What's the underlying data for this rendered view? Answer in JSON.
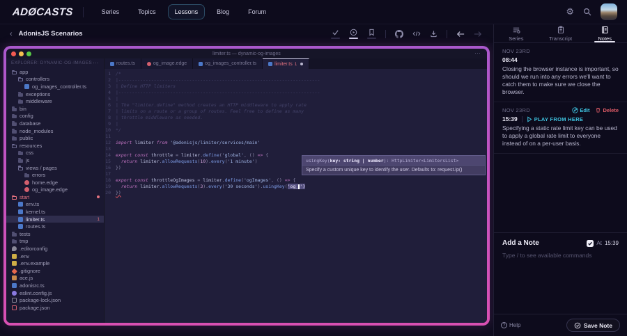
{
  "colors": {
    "page_bg": "#0d0b1c",
    "panel_border": "#201e33",
    "accent_cyan": "#3fc4e0",
    "accent_red": "#e25d68",
    "accent_salmon": "#e57380",
    "chrome_bg": "#161528",
    "explorer_bg": "#1a1831",
    "editor_bg": "#201e3a",
    "ts_blue": "#4c78c8",
    "edge_red": "#d35f6e",
    "window_border_top": "#aa58cc",
    "window_border_bottom": "#d950b2"
  },
  "navbar": {
    "brand": "ADØCASTS",
    "items": [
      {
        "label": "Series",
        "active": false
      },
      {
        "label": "Topics",
        "active": false
      },
      {
        "label": "Lessons",
        "active": true
      },
      {
        "label": "Blog",
        "active": false
      },
      {
        "label": "Forum",
        "active": false
      }
    ],
    "icons": [
      "gear-icon",
      "search-icon",
      "avatar"
    ]
  },
  "lesson_bar": {
    "back_icon": "‹",
    "title": "AdonisJS Scenarios",
    "tools": [
      {
        "name": "mark-complete",
        "icon": "check",
        "underline": "dim"
      },
      {
        "name": "autoplay",
        "icon": "play-circle",
        "underline": "bright"
      },
      {
        "name": "bookmark",
        "icon": "bookmark",
        "underline": "dim"
      },
      {
        "name": "github",
        "icon": "github"
      },
      {
        "name": "embed",
        "icon": "code"
      },
      {
        "name": "download",
        "icon": "download"
      },
      {
        "name": "previous-lesson",
        "icon": "arrow-left",
        "disabled": false
      },
      {
        "name": "next-lesson",
        "icon": "arrow-right",
        "disabled": true
      }
    ]
  },
  "editor": {
    "window_title": "limiter.ts — dynamic-og-images",
    "explorer_header": "EXPLORER: DYNAMIC-OG-IMAGES",
    "more_glyph": "⋯",
    "tree": [
      {
        "name": "app",
        "icon": "folder-open",
        "indent": 0
      },
      {
        "name": "controllers",
        "icon": "folder-open",
        "indent": 1
      },
      {
        "name": "og_images_controller.ts",
        "icon": "ts",
        "indent": 2
      },
      {
        "name": "exceptions",
        "icon": "folder",
        "indent": 1
      },
      {
        "name": "middleware",
        "icon": "folder",
        "indent": 1
      },
      {
        "name": "bin",
        "icon": "folder",
        "indent": 0
      },
      {
        "name": "config",
        "icon": "folder",
        "indent": 0
      },
      {
        "name": "database",
        "icon": "folder",
        "indent": 0
      },
      {
        "name": "node_modules",
        "icon": "folder",
        "indent": 0
      },
      {
        "name": "public",
        "icon": "folder",
        "indent": 0
      },
      {
        "name": "resources",
        "icon": "folder-open",
        "indent": 0
      },
      {
        "name": "css",
        "icon": "folder",
        "indent": 1
      },
      {
        "name": "js",
        "icon": "folder",
        "indent": 1
      },
      {
        "name": "views / pages",
        "icon": "folder-open",
        "indent": 1
      },
      {
        "name": "errors",
        "icon": "folder",
        "indent": 2
      },
      {
        "name": "home.edge",
        "icon": "edge",
        "indent": 2
      },
      {
        "name": "og_image.edge",
        "icon": "edge",
        "indent": 2
      },
      {
        "name": "start",
        "icon": "folder-open",
        "indent": 0,
        "salmon": true,
        "dot": true
      },
      {
        "name": "env.ts",
        "icon": "ts",
        "indent": 1
      },
      {
        "name": "kernel.ts",
        "icon": "ts",
        "indent": 1
      },
      {
        "name": "limiter.ts",
        "icon": "ts",
        "indent": 1,
        "selected": true,
        "badge": "1"
      },
      {
        "name": "routes.ts",
        "icon": "ts",
        "indent": 1
      },
      {
        "name": "tests",
        "icon": "folder",
        "indent": 0
      },
      {
        "name": "tmp",
        "icon": "folder",
        "indent": 0
      },
      {
        "name": ".editorconfig",
        "icon": "editorconfig",
        "indent": 0
      },
      {
        "name": ".env",
        "icon": "env",
        "indent": 0
      },
      {
        "name": ".env.example",
        "icon": "env",
        "indent": 0
      },
      {
        "name": ".gitignore",
        "icon": "git",
        "indent": 0
      },
      {
        "name": "ace.js",
        "icon": "js",
        "indent": 0
      },
      {
        "name": "adonisrc.ts",
        "icon": "ts",
        "indent": 0
      },
      {
        "name": "eslint.config.js",
        "icon": "eslint",
        "indent": 0
      },
      {
        "name": "package-lock.json",
        "icon": "json-lock",
        "indent": 0
      },
      {
        "name": "package.json",
        "icon": "json",
        "indent": 0
      }
    ],
    "tabs": [
      {
        "label": "routes.ts",
        "icon": "ts",
        "active": false
      },
      {
        "label": "og_image.edge",
        "icon": "edge",
        "active": false
      },
      {
        "label": "og_images_controller.ts",
        "icon": "ts",
        "active": false
      },
      {
        "label": "limiter.ts",
        "icon": "ts",
        "active": true,
        "badge": "1",
        "modified": true
      }
    ],
    "code": [
      {
        "n": 1,
        "seg": [
          [
            "c",
            "/*"
          ]
        ]
      },
      {
        "n": 2,
        "seg": [
          [
            "c",
            "|--------------------------------------------------------------------------"
          ]
        ]
      },
      {
        "n": 3,
        "seg": [
          [
            "c",
            "| Define HTTP limiters"
          ]
        ]
      },
      {
        "n": 4,
        "seg": [
          [
            "c",
            "|--------------------------------------------------------------------------"
          ]
        ]
      },
      {
        "n": 5,
        "seg": [
          [
            "c",
            "|"
          ]
        ]
      },
      {
        "n": 6,
        "seg": [
          [
            "c",
            "| The \"limiter.define\" method creates an HTTP middleware to apply rate"
          ]
        ]
      },
      {
        "n": 7,
        "seg": [
          [
            "c",
            "| limits on a route or a group of routes. Feel free to define as many"
          ]
        ]
      },
      {
        "n": 8,
        "seg": [
          [
            "c",
            "| throttle middleware as needed."
          ]
        ]
      },
      {
        "n": 9,
        "seg": [
          [
            "c",
            "|"
          ]
        ]
      },
      {
        "n": 10,
        "seg": [
          [
            "c",
            "*/"
          ]
        ]
      },
      {
        "n": 11,
        "seg": []
      },
      {
        "n": 12,
        "seg": [
          [
            "k",
            "import"
          ],
          [
            "v",
            " limiter "
          ],
          [
            "k",
            "from"
          ],
          [
            "s",
            " '@adonisjs/limiter/services/main'"
          ]
        ]
      },
      {
        "n": 13,
        "seg": []
      },
      {
        "n": 14,
        "seg": [
          [
            "k",
            "export const"
          ],
          [
            "v",
            " throttle "
          ],
          [
            "p",
            "= "
          ],
          [
            "v",
            "limiter"
          ],
          [
            "p",
            "."
          ],
          [
            "f",
            "define"
          ],
          [
            "p",
            "("
          ],
          [
            "s",
            "'global'"
          ],
          [
            "p",
            ", () "
          ],
          [
            "k",
            "=>"
          ],
          [
            "p",
            " {"
          ]
        ]
      },
      {
        "n": 15,
        "seg": [
          [
            "d",
            "  "
          ],
          [
            "k",
            "return"
          ],
          [
            "v",
            " limiter"
          ],
          [
            "p",
            "."
          ],
          [
            "f",
            "allowRequests"
          ],
          [
            "p",
            "("
          ],
          [
            "n",
            "10"
          ],
          [
            "p",
            ")."
          ],
          [
            "f",
            "every"
          ],
          [
            "p",
            "("
          ],
          [
            "s",
            "'1 minute'"
          ],
          [
            "p",
            ")"
          ]
        ]
      },
      {
        "n": 16,
        "seg": [
          [
            "p",
            "})"
          ]
        ]
      },
      {
        "n": 17,
        "seg": []
      },
      {
        "n": 18,
        "seg": [
          [
            "k",
            "export const"
          ],
          [
            "v",
            " throttleOgImages "
          ],
          [
            "p",
            "= "
          ],
          [
            "v",
            "limiter"
          ],
          [
            "p",
            "."
          ],
          [
            "f",
            "define"
          ],
          [
            "p",
            "("
          ],
          [
            "s",
            "'ogImages'"
          ],
          [
            "p",
            ", () "
          ],
          [
            "k",
            "=>"
          ],
          [
            "p",
            " {"
          ]
        ]
      },
      {
        "n": 19,
        "seg": [
          [
            "d",
            "  "
          ],
          [
            "k",
            "return"
          ],
          [
            "v",
            " limiter"
          ],
          [
            "p",
            "."
          ],
          [
            "f",
            "allowRequests"
          ],
          [
            "p",
            "("
          ],
          [
            "n",
            "3"
          ],
          [
            "p",
            ")."
          ],
          [
            "f",
            "every"
          ],
          [
            "p",
            "("
          ],
          [
            "s",
            "'30 seconds'"
          ],
          [
            "p",
            ")."
          ],
          [
            "f",
            "usingKey"
          ],
          [
            "p",
            "("
          ],
          [
            "sel",
            "'og_"
          ],
          [
            "cur",
            ""
          ],
          [
            "sel",
            "')"
          ]
        ]
      },
      {
        "n": 20,
        "seg": [
          [
            "err",
            "})"
          ]
        ]
      }
    ],
    "tooltip": {
      "pre": "usingKey(",
      "params": "key: string | number",
      "post": "): HttpLimiter<LimitersList>",
      "description": "Specify a custom unique key to identify the user. Defaults to: request.ip()"
    }
  },
  "panel": {
    "tabs": [
      {
        "label": "Series",
        "active": false
      },
      {
        "label": "Transcript",
        "active": false
      },
      {
        "label": "Notes",
        "active": true
      }
    ],
    "notes": [
      {
        "date": "NOV 23RD",
        "time": "08:44",
        "has_actions": false,
        "has_play": false,
        "text": "Closing the browser instance is important, so should we run into any errors we'll want to catch them to make sure we close the browser."
      },
      {
        "date": "NOV 23RD",
        "time": "15:39",
        "has_actions": true,
        "has_play": true,
        "edit_label": "Edit",
        "delete_label": "Delete",
        "play_label": "PLAY FROM HERE",
        "text": "Specifying a static rate limit key can be used to apply a global rate limit to everyone instead of on a per-user basis."
      }
    ],
    "add_note": {
      "title": "Add a Note",
      "at_label": "At",
      "at_time": "15:39",
      "checked": true,
      "placeholder": "Type / to see available commands",
      "help_label": "Help",
      "save_label": "Save Note"
    }
  }
}
